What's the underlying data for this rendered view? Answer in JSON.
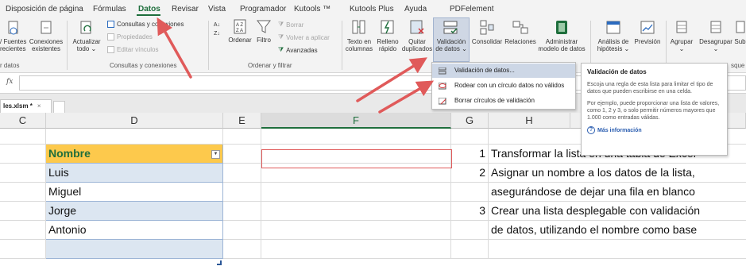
{
  "tabs": [
    {
      "label": "Disposición de página"
    },
    {
      "label": "Fórmulas"
    },
    {
      "label": "Datos",
      "active": true
    },
    {
      "label": "Revisar"
    },
    {
      "label": "Vista"
    },
    {
      "label": "Programador"
    },
    {
      "label": "Kutools ™"
    },
    {
      "label": "Kutools Plus"
    },
    {
      "label": "Ayuda"
    },
    {
      "label": "PDFelement"
    }
  ],
  "ribbon": {
    "fuentes": {
      "line1": "/ Fuentes",
      "line2": "recientes"
    },
    "conexiones": {
      "line1": "Conexiones",
      "line2": "existentes"
    },
    "actualizar": {
      "line1": "Actualizar",
      "line2": "todo ⌄"
    },
    "consultas_conexiones": "Consultas y conexiones",
    "propiedades": "Propiedades",
    "editar_vinculos": "Editar vínculos",
    "ordenar": "Ordenar",
    "filtro": "Filtro",
    "borrar": "Borrar",
    "volver_aplicar": "Volver a aplicar",
    "avanzadas": "Avanzadas",
    "texto_columnas": {
      "line1": "Texto en",
      "line2": "columnas"
    },
    "relleno_rapido": {
      "line1": "Relleno",
      "line2": "rápido"
    },
    "quitar_duplicados": {
      "line1": "Quitar",
      "line2": "duplicados"
    },
    "validacion": {
      "line1": "Validación",
      "line2": "de datos ⌄"
    },
    "consolidar": "Consolidar",
    "relaciones": "Relaciones",
    "administrar_modelo": {
      "line1": "Administrar",
      "line2": "modelo de datos"
    },
    "analisis_hipotesis": {
      "line1": "Análisis de",
      "line2": "hipótesis ⌄"
    },
    "prevision": {
      "line1": "Previsión",
      "line2": ""
    },
    "agrupar": {
      "line1": "Agrupar",
      "line2": "⌄"
    },
    "desagrupar": {
      "line1": "Desagrupar",
      "line2": "⌄"
    },
    "sub": "Sub",
    "groups": {
      "datos_cut": "r datos",
      "consultas": "Consultas y conexiones",
      "ordenar_filtrar": "Ordenar y filtrar",
      "esquema_cut": "sque"
    }
  },
  "menu": {
    "items": [
      {
        "label": "Validación de datos...",
        "hovered": true
      },
      {
        "label": "Rodear con un círculo datos no válidos"
      },
      {
        "label": "Borrar círculos de validación"
      }
    ]
  },
  "tooltip": {
    "title": "Validación de datos",
    "p1": "Escoja una regla de esta lista para limitar el tipo de datos que pueden escribirse en una celda.",
    "p2": "Por ejemplo, puede proporcionar una lista de valores, como 1, 2 y 3, o solo permitir números mayores que 1.000 como entradas válidas.",
    "more": "Más información"
  },
  "formula_bar": {
    "fx": "fx"
  },
  "sheet_tab": {
    "name": "les.xlsm *",
    "close": "×"
  },
  "columns": [
    "C",
    "D",
    "E",
    "F",
    "G",
    "H"
  ],
  "table": {
    "header": "Nombre",
    "rows": [
      "Luis",
      "Miguel",
      "Jorge",
      "Antonio",
      ""
    ]
  },
  "steps": [
    {
      "num": "1",
      "text": "Transformar la lista en una tabla de Excel"
    },
    {
      "num": "2",
      "text": "Asignar un nombre a los datos de la lista,"
    },
    {
      "num": "",
      "text": "asegurándose de dejar una fila en blanco"
    },
    {
      "num": "3",
      "text": "Crear una lista desplegable con validación"
    },
    {
      "num": "",
      "text": "de datos, utilizando el nombre como base"
    }
  ],
  "colors": {
    "excel_green": "#1e6e3c",
    "table_header": "#fdc94c",
    "table_band": "#dce6f1",
    "annotation_red": "#e05a5a"
  }
}
